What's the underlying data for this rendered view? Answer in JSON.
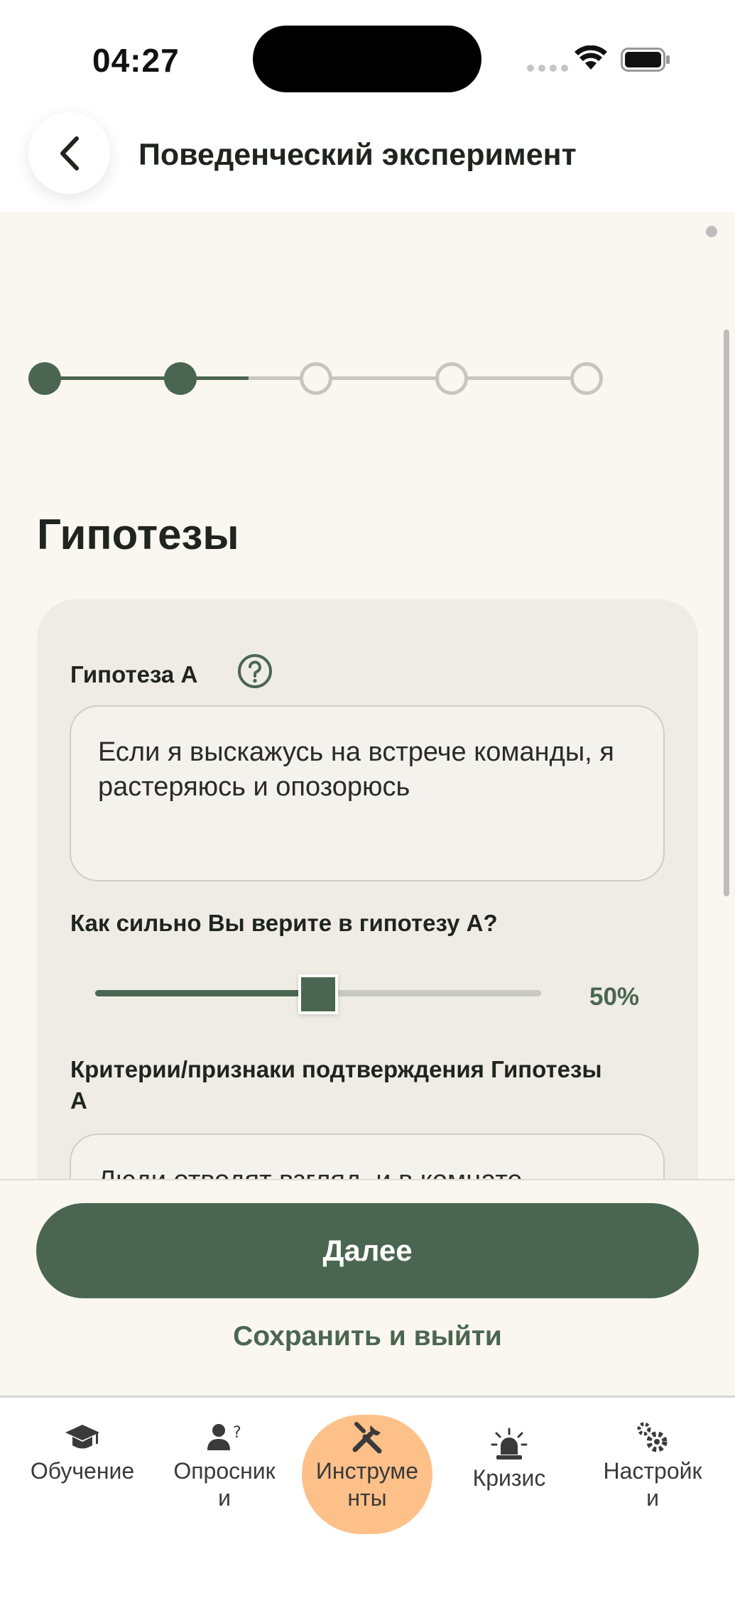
{
  "status_bar": {
    "time": "04:27"
  },
  "header": {
    "title": "Поведенческий эксперимент"
  },
  "stepper": {
    "total_steps": 5,
    "completed_steps": 2
  },
  "section": {
    "title": "Гипотезы"
  },
  "hypothesis_a": {
    "label": "Гипотеза А",
    "value": "Если я выскажусь на встрече команды, я растеряюсь и опозорюсь",
    "belief_question": "Как сильно Вы верите в гипотезу А?",
    "belief_value": 50,
    "belief_text": "50%",
    "criteria_label": "Критерии/признаки подтверждения Гипотезы А",
    "criteria_value": "Люди отводят взгляд, и в комнате"
  },
  "actions": {
    "next_label": "Далее",
    "save_exit_label": "Сохранить и выйти"
  },
  "tabs": [
    {
      "label": "Обучение",
      "icon": "graduation-cap-icon",
      "active": false
    },
    {
      "label": "Опросники",
      "icon": "user-question-icon",
      "active": false
    },
    {
      "label": "Инструменты",
      "icon": "tools-icon",
      "active": true
    },
    {
      "label": "Кризис",
      "icon": "alarm-siren-icon",
      "active": false
    },
    {
      "label": "Настройки",
      "icon": "gears-icon",
      "active": false
    }
  ],
  "colors": {
    "accent": "#4b6650",
    "active_tab": "#fec089",
    "background": "#faf7f1",
    "card": "#efece6"
  }
}
